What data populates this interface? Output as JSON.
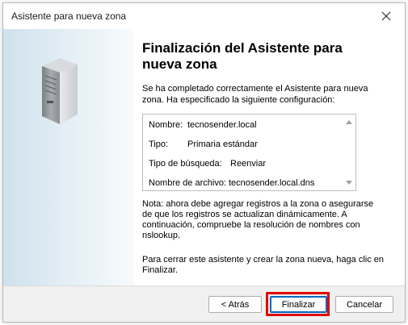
{
  "window": {
    "title": "Asistente para nueva zona",
    "close_glyph": "✕"
  },
  "main": {
    "heading": "Finalización del Asistente para nueva zona",
    "intro": "Se ha completado correctamente el Asistente para nueva zona. Ha especificado la siguiente configuración:",
    "summary": [
      {
        "label": "Nombre:",
        "value": "tecnosender.local"
      },
      {
        "label": "Tipo:",
        "value": "Primaria estándar"
      },
      {
        "label": "Tipo de búsqueda:",
        "value": "Reenviar"
      },
      {
        "label": "Nombre de archivo:",
        "value": "tecnosender.local.dns"
      }
    ],
    "note": "Nota: ahora debe agregar registros a la zona o asegurarse de que los registros se actualizan dinámicamente. A continuación, compruebe la resolución de nombres con nslookup.",
    "closing": "Para cerrar este asistente y crear la zona nueva, haga clic en Finalizar."
  },
  "buttons": {
    "back": "< Atrás",
    "finish": "Finalizar",
    "cancel": "Cancelar"
  },
  "icons": {
    "side_image": "server-icon",
    "close": "close-icon",
    "scroll_up": "scroll-up-arrow-icon",
    "scroll_down": "scroll-down-arrow-icon"
  },
  "colors": {
    "highlight": "#e00000",
    "default_button_border": "#0067c0"
  }
}
